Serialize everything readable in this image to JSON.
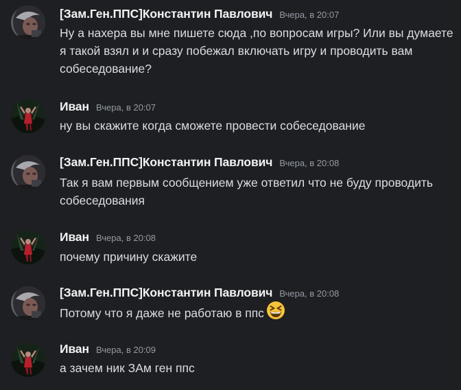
{
  "messages": [
    {
      "author": "[Зам.Ген.ППС]Константин Павлович",
      "timestamp": "Вчера, в 20:07",
      "text": "Ну а нахера вы мне пишете сюда ,по вопросам игры? Или вы думаете я такой взял и и сразу побежал включать игру и проводить вам собеседование?",
      "avatar": "konstantin-avatar"
    },
    {
      "author": "Иван",
      "timestamp": "Вчера, в 20:07",
      "text": "ну вы скажите когда сможете провести собеседование",
      "avatar": "ivan-avatar"
    },
    {
      "author": "[Зам.Ген.ППС]Константин Павлович",
      "timestamp": "Вчера, в 20:08",
      "text": "Так я вам первым сообщением уже ответил что не буду проводить собеседования",
      "avatar": "konstantin-avatar"
    },
    {
      "author": "Иван",
      "timestamp": "Вчера, в 20:08",
      "text": "почему причину скажите",
      "avatar": "ivan-avatar"
    },
    {
      "author": "[Зам.Ген.ППС]Константин Павлович",
      "timestamp": "Вчера, в 20:08",
      "text": "Потому что я даже не работаю в ппс",
      "emoji": "laughing-face-emoji",
      "avatar": "konstantin-avatar"
    },
    {
      "author": "Иван",
      "timestamp": "Вчера, в 20:09",
      "text": "а зачем ник ЗАм ген ппс",
      "avatar": "ivan-avatar"
    }
  ],
  "colors": {
    "background": "#1e1f22",
    "author": "#f2f3f5",
    "text": "#dbdee1",
    "timestamp": "#949ba4",
    "emoji": "#f5c33b"
  }
}
